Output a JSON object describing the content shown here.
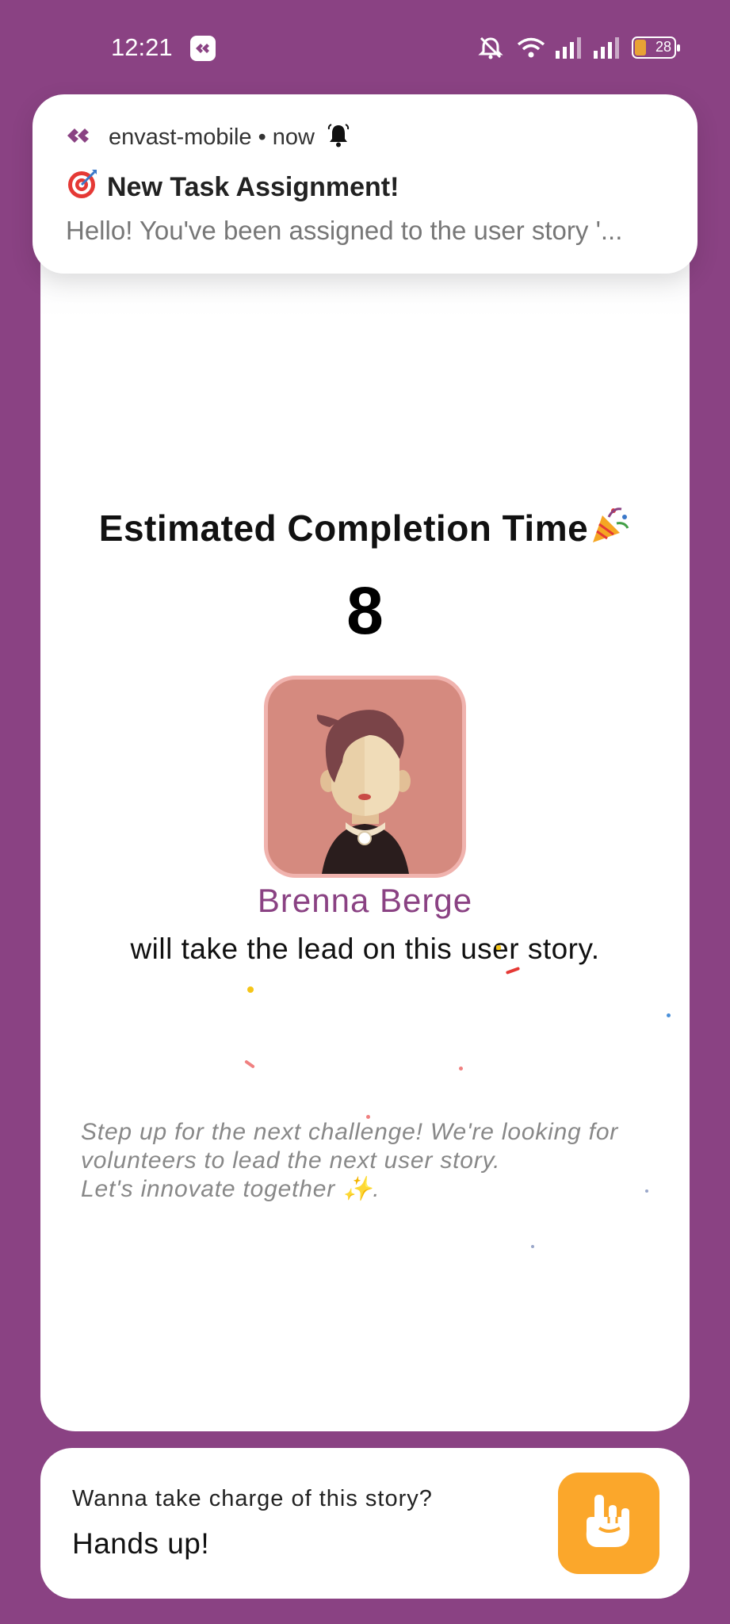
{
  "status_bar": {
    "time": "12:21",
    "battery_level": "28",
    "icons": [
      "app-badge-icon",
      "mute-icon",
      "wifi-icon",
      "signal-icon",
      "signal-icon",
      "battery-icon"
    ]
  },
  "notification": {
    "app_name": "envast-mobile • now",
    "title": "New Task Assignment!",
    "body": "Hello! You've been assigned to the user story '...",
    "icons": [
      "app-logo-icon",
      "bell-icon",
      "target-icon"
    ]
  },
  "main": {
    "heading": "Estimated Completion Time",
    "estimate_value": "8",
    "assignee_name": "Brenna Berge",
    "lead_text": "will take the lead on this user story.",
    "volunteer_lines": [
      "Step up for the next challenge! We're looking for",
      "volunteers to lead the next user story.",
      "Let's innovate together ✨."
    ]
  },
  "bottom": {
    "question": "Wanna take charge of this story?",
    "cta": "Hands up!",
    "button_icon": "hand-raise-icon"
  },
  "colors": {
    "background": "#8a4283",
    "accent": "#8a4283",
    "button": "#fba72b",
    "avatar_bg": "#d58a7f"
  }
}
